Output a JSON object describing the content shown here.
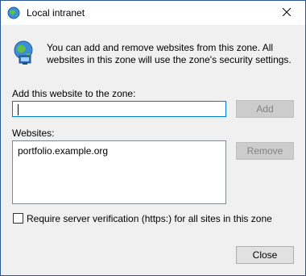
{
  "window": {
    "title": "Local intranet",
    "close_glyph": "✕"
  },
  "intro": {
    "text": "You can add and remove websites from this zone. All websites in this zone will use the zone's security settings."
  },
  "add_section": {
    "label": "Add this website to the zone:",
    "input_value": "",
    "add_label": "Add"
  },
  "websites_section": {
    "label": "Websites:",
    "items": [
      "portfolio.example.org"
    ],
    "remove_label": "Remove"
  },
  "verification": {
    "label": "Require server verification (https:) for all sites in this zone",
    "checked": false
  },
  "footer": {
    "close_label": "Close"
  },
  "colors": {
    "accent": "#0078d7",
    "disabled_text": "#838383"
  }
}
